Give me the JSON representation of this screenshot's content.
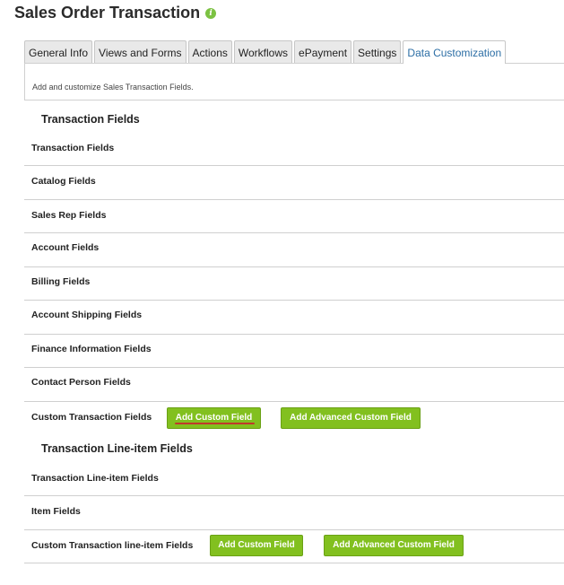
{
  "page": {
    "title": "Sales Order Transaction",
    "info_icon": "info-icon"
  },
  "tabs": [
    {
      "label": "General Info",
      "active": false
    },
    {
      "label": "Views and Forms",
      "active": false
    },
    {
      "label": "Actions",
      "active": false
    },
    {
      "label": "Workflows",
      "active": false
    },
    {
      "label": "ePayment",
      "active": false
    },
    {
      "label": "Settings",
      "active": false
    },
    {
      "label": "Data Customization",
      "active": true
    }
  ],
  "description": "Add and customize Sales Transaction Fields.",
  "transaction_section": {
    "heading": "Transaction Fields",
    "rows": [
      "Transaction Fields",
      "Catalog Fields",
      "Sales Rep Fields",
      "Account Fields",
      "Billing Fields",
      "Account Shipping Fields",
      "Finance Information Fields",
      "Contact Person Fields"
    ],
    "custom_row": {
      "label": "Custom Transaction Fields",
      "add_custom_label": "Add Custom Field",
      "add_advanced_label": "Add Advanced Custom Field"
    }
  },
  "lineitem_section": {
    "heading": "Transaction Line-item Fields",
    "rows": [
      "Transaction Line-item Fields",
      "Item Fields"
    ],
    "custom_row": {
      "label": "Custom Transaction line-item Fields",
      "add_custom_label": "Add Custom Field",
      "add_advanced_label": "Add Advanced Custom Field"
    }
  },
  "colors": {
    "accent_green": "#82c01f",
    "active_tab_text": "#2c6ea5",
    "annotation_underline": "#c0392b"
  }
}
